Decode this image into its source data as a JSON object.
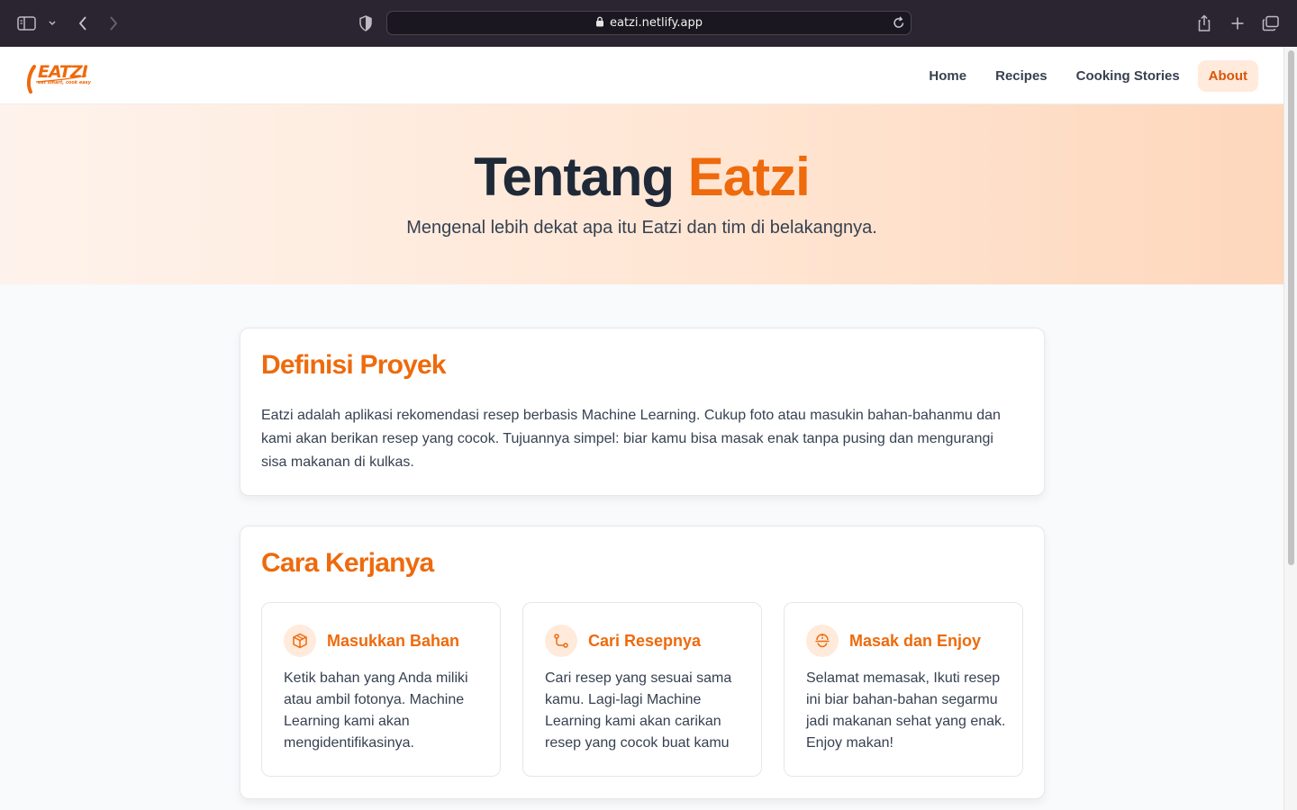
{
  "browser": {
    "url": "eatzi.netlify.app",
    "icons": [
      "sidebar-icon",
      "chevron-down-icon",
      "back-icon",
      "forward-icon",
      "shield-icon",
      "lock-icon",
      "reload-icon",
      "share-icon",
      "plus-icon",
      "tabs-icon"
    ]
  },
  "nav": {
    "logo_text": "EATZI",
    "logo_tagline": "eat smart, cook easy",
    "items": [
      {
        "label": "Home",
        "active": false
      },
      {
        "label": "Recipes",
        "active": false
      },
      {
        "label": "Cooking Stories",
        "active": false
      },
      {
        "label": "About",
        "active": true
      }
    ]
  },
  "hero": {
    "title_prefix": "Tentang",
    "title_accent": "Eatzi",
    "subtitle": "Mengenal lebih dekat apa itu Eatzi dan tim di belakangnya."
  },
  "definition": {
    "heading": "Definisi Proyek",
    "body": "Eatzi adalah aplikasi rekomendasi resep berbasis Machine Learning. Cukup foto atau masukin bahan-bahanmu dan kami akan berikan resep yang cocok. Tujuannya simpel: biar kamu bisa masak enak tanpa pusing dan mengurangi sisa makanan di kulkas."
  },
  "how_it_works": {
    "heading": "Cara Kerjanya",
    "steps": [
      {
        "icon": "box-icon",
        "title": "Masukkan Bahan",
        "body": "Ketik bahan yang Anda miliki atau ambil fotonya. Machine Learning kami akan mengidentifikasinya."
      },
      {
        "icon": "route-icon",
        "title": "Cari Resepnya",
        "body": "Cari resep yang sesuai sama kamu. Lagi-lagi Machine Learning kami akan carikan resep yang cocok buat kamu"
      },
      {
        "icon": "cooking-icon",
        "title": "Masak dan Enjoy",
        "body": "Selamat memasak, Ikuti resep ini biar bahan-bahan segarmu jadi makanan sehat yang enak. Enjoy makan!"
      }
    ]
  },
  "colors": {
    "accent": "#ee6a0c",
    "accent_soft": "#ffeadb",
    "text": "#1f2937"
  }
}
